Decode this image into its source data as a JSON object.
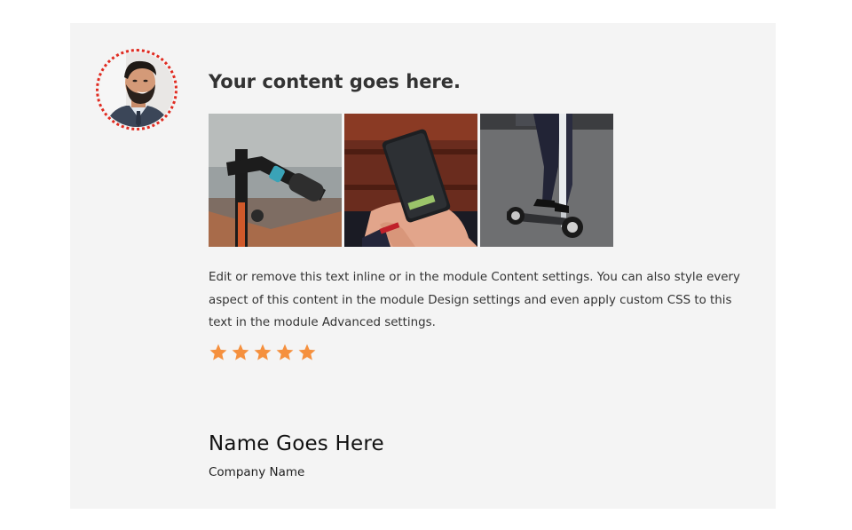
{
  "testimonial": {
    "title": "Your content goes here.",
    "body": "Edit or remove this text inline or in the module Content settings. You can also style every aspect of this content in the module Design settings and even apply custom CSS to this text in the module Advanced settings.",
    "rating": 5,
    "rating_max": 5,
    "name": "Name Goes Here",
    "company": "Company Name"
  },
  "colors": {
    "card_background": "#f4f4f4",
    "avatar_ring": "#e02b20",
    "star": "#f5903e",
    "heading_text": "#333333"
  },
  "gallery": {
    "images": [
      {
        "subject": "scooter-handlebar-photo"
      },
      {
        "subject": "hand-holding-phone-photo"
      },
      {
        "subject": "person-standing-on-scooter-photo"
      }
    ]
  }
}
